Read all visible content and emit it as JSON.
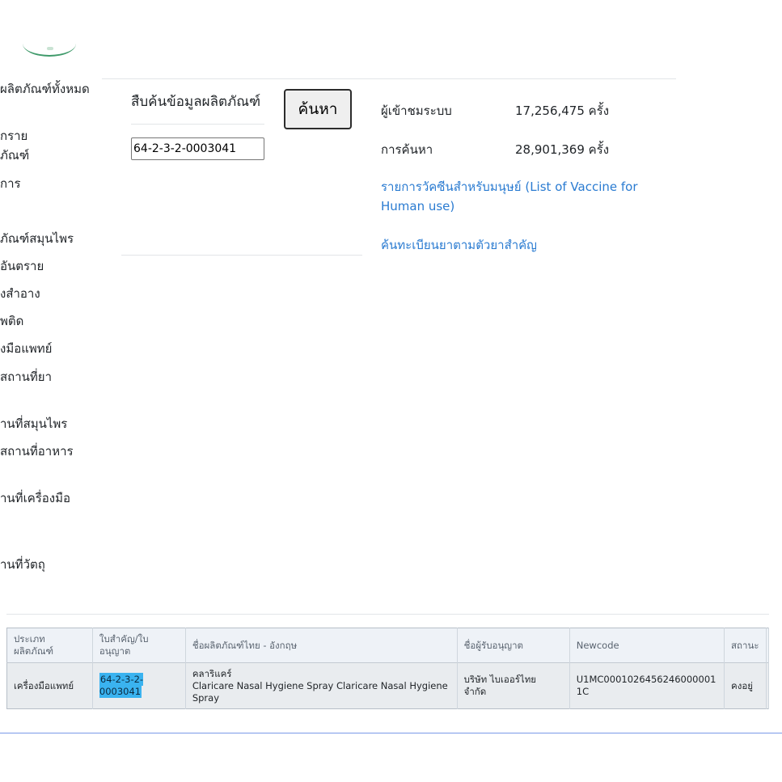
{
  "sidebar": {
    "items": [
      "ผลิตภัณฑ์ทั้งหมด",
      "อันตราย",
      "ภัณฑ์",
      "ยาการ",
      "ผลิตภัณฑ์สมุนไพร",
      "วัตถุอันตราย",
      "เครื่องสำอาง",
      "ยาเสพติด",
      "เครื่องมือแพทย์",
      "สถานที่ยา",
      "สถานที่สมุนไพร",
      "สถานที่อาหาร",
      "สถานที่เครื่องมือ",
      "สถานที่วัตถุ"
    ],
    "visible_text": [
      "ผลิตภัณฑ์ทั้งหมด",
      "กราย",
      "ภัณฑ์",
      "การ",
      "ภัณฑ์สมุนไพร",
      "อันตราย",
      "งสำอาง",
      "พติด",
      "งมือแพทย์",
      "สถานที่ยา",
      "านที่สมุนไพร",
      "สถานที่อาหาร",
      "านที่เครื่องมือ",
      "านที่วัตถุ"
    ]
  },
  "search": {
    "title": "สืบค้นข้อมูลผลิตภัณฑ์",
    "input_value": "64-2-3-2-0003041",
    "button_label": "ค้นหา"
  },
  "stats": {
    "visitors_label": "ผู้เข้าชมระบบ",
    "visitors_value": "17,256,475 ครั้ง",
    "searches_label": "การค้นหา",
    "searches_value": "28,901,369 ครั้ง"
  },
  "links": {
    "vaccine_line1": "รายการวัคซีนสำหรับมนุษย์ (List of Vaccine for",
    "vaccine_line2": "Human use)",
    "drug_registry": "ค้นทะเบียนยาตามตัวยาสำคัญ"
  },
  "results": {
    "headers": {
      "type_line1": "ประเภท",
      "type_line2": "ผลิตภัณฑ์",
      "license_line1": "ใบสำคัญ/ใบ",
      "license_line2": "อนุญาต",
      "product_name": "ชื่อผลิตภัณฑ์ไทย - อังกฤษ",
      "licensee": "ชื่อผู้รับอนุญาต",
      "newcode": "Newcode",
      "status": "สถานะ"
    },
    "rows": [
      {
        "type": "เครื่องมือแพทย์",
        "license": "64-2-3-2-0003041",
        "name_th": "คลาริแคร์",
        "name_en_line1": "Claricare Nasal Hygiene Spray Claricare Nasal Hygiene",
        "name_en_line2": "Spray",
        "licensee_line1": "บริษัท ไบเออร์ไทย",
        "licensee_line2": "จำกัด",
        "newcode": "U1MC0001026456246000001 1C",
        "status": "คงอยู่"
      }
    ]
  }
}
